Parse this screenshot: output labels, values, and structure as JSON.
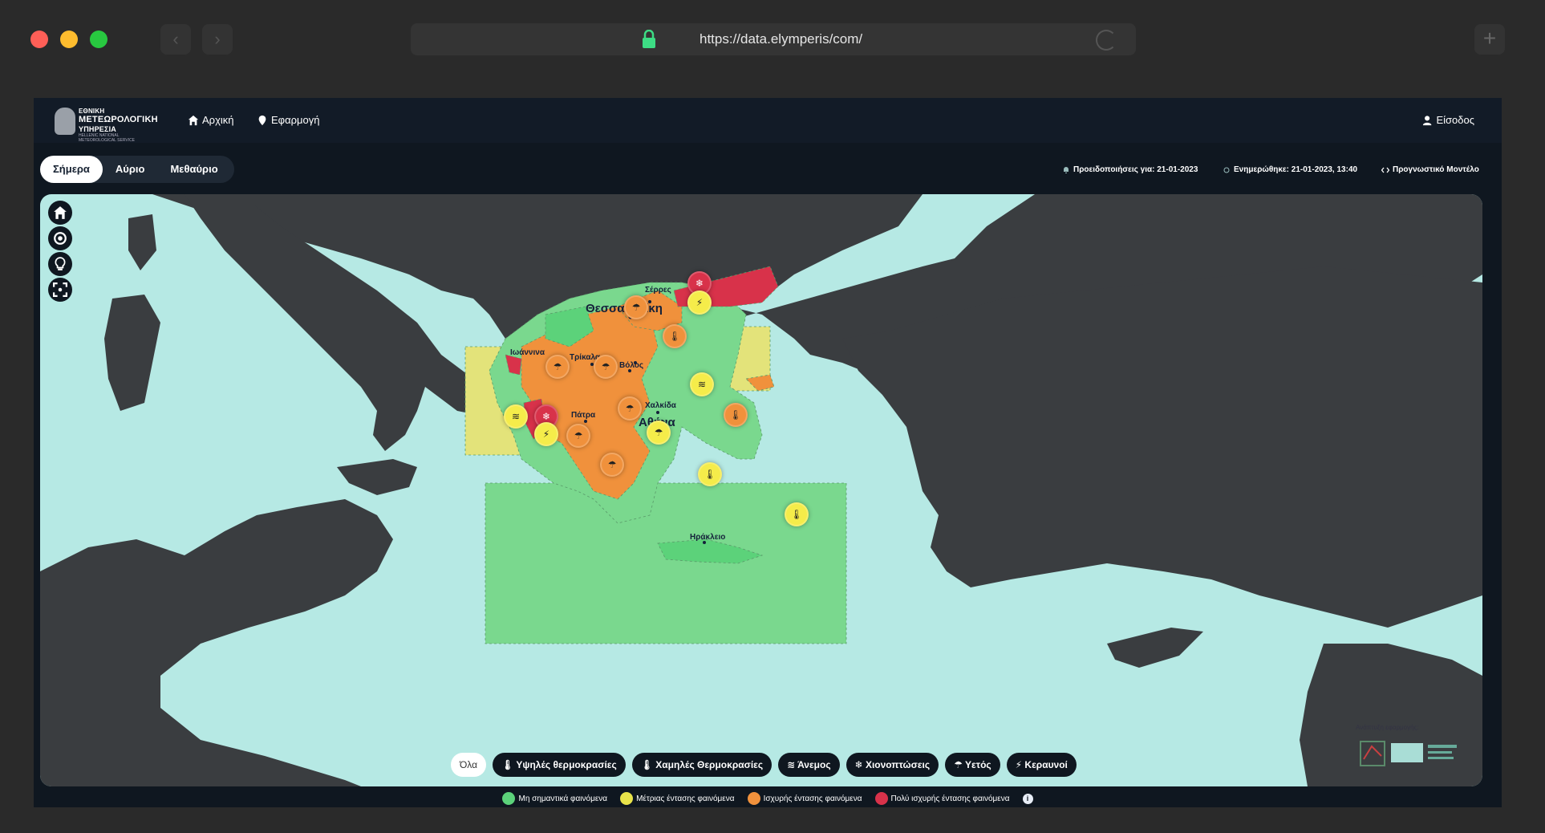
{
  "browser": {
    "url": "https://data.elymperis/com/",
    "back_glyph": "‹",
    "forward_glyph": "›",
    "new_tab_glyph": "+"
  },
  "header": {
    "logo_line1": "ΕΘΝΙΚΗ",
    "logo_line2": "ΜΕΤΕΩΡΟΛΟΓΙΚΗ",
    "logo_line3": "ΥΠΗΡΕΣΙΑ",
    "logo_line4": "HELLENIC NATIONAL METEOROLOGICAL SERVICE",
    "nav": [
      {
        "label": "Αρχική",
        "icon": "home-icon"
      },
      {
        "label": "Εφαρμογή",
        "icon": "pin-icon"
      }
    ],
    "login": "Είσοδος"
  },
  "day_tabs": [
    {
      "label": "Σήμερα",
      "active": true
    },
    {
      "label": "Αύριο",
      "active": false
    },
    {
      "label": "Μεθαύριο",
      "active": false
    }
  ],
  "info": {
    "warnings": "Προειδοποιήσεις για: 21-01-2023",
    "updated": "Ενημερώθηκε: 21-01-2023, 13:40",
    "model": "Προγνωστικό Μοντέλο"
  },
  "map": {
    "controls": [
      "home-icon",
      "locate-icon",
      "bulb-icon",
      "fullscreen-icon"
    ],
    "cities": {
      "serres": "Σέρρες",
      "thessaloniki": "Θεσσαλονίκη",
      "ioannina": "Ιωάννινα",
      "trikala": "Τρίκαλα",
      "volos": "Βόλος",
      "chalkida": "Χαλκίδα",
      "patra": "Πάτρα",
      "athina": "Αθήνα",
      "irakleio": "Ηράκλειο"
    },
    "filters": [
      "Όλα",
      "Υψηλές θερμοκρασίες",
      "Χαμηλές Θερμοκρασίες",
      "Άνεμος",
      "Χιονοπτώσεις",
      "Υετός",
      "Κεραυνοί"
    ],
    "credit": "Ανάπτυξη εφαρμογής:"
  },
  "legend": [
    {
      "label": "Μη σημαντικά φαινόμενα",
      "color": "#5cd27a"
    },
    {
      "label": "Μέτριας έντασης φαινόμενα",
      "color": "#e8e34a"
    },
    {
      "label": "Ισχυρής έντασης φαινόμενα",
      "color": "#f0913c"
    },
    {
      "label": "Πολύ ισχυρής έντασης φαινόμενα",
      "color": "#d8324a"
    }
  ],
  "legend_info": "i",
  "colors": {
    "sea": "#b6e9e4",
    "land": "#3a3d40",
    "green": "#7ad88e",
    "yellow": "#e3e37a",
    "orange": "#f0913c",
    "red": "#d8324a"
  }
}
